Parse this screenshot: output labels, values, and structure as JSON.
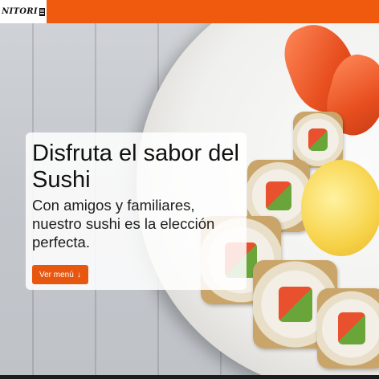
{
  "navbar": {
    "brand": "NITORI",
    "accent_color": "#f05a0e",
    "brand_icon": "sushi-box-logo"
  },
  "hero": {
    "title": "Disfruta el sabor del Sushi",
    "subtitle": "Con amigos y familiares, nuestro sushi es la elección perfecta.",
    "button_label": "Ver menú",
    "button_icon": "arrow-down-icon",
    "button_icon_glyph": "↓",
    "button_color": "#e8570f"
  }
}
